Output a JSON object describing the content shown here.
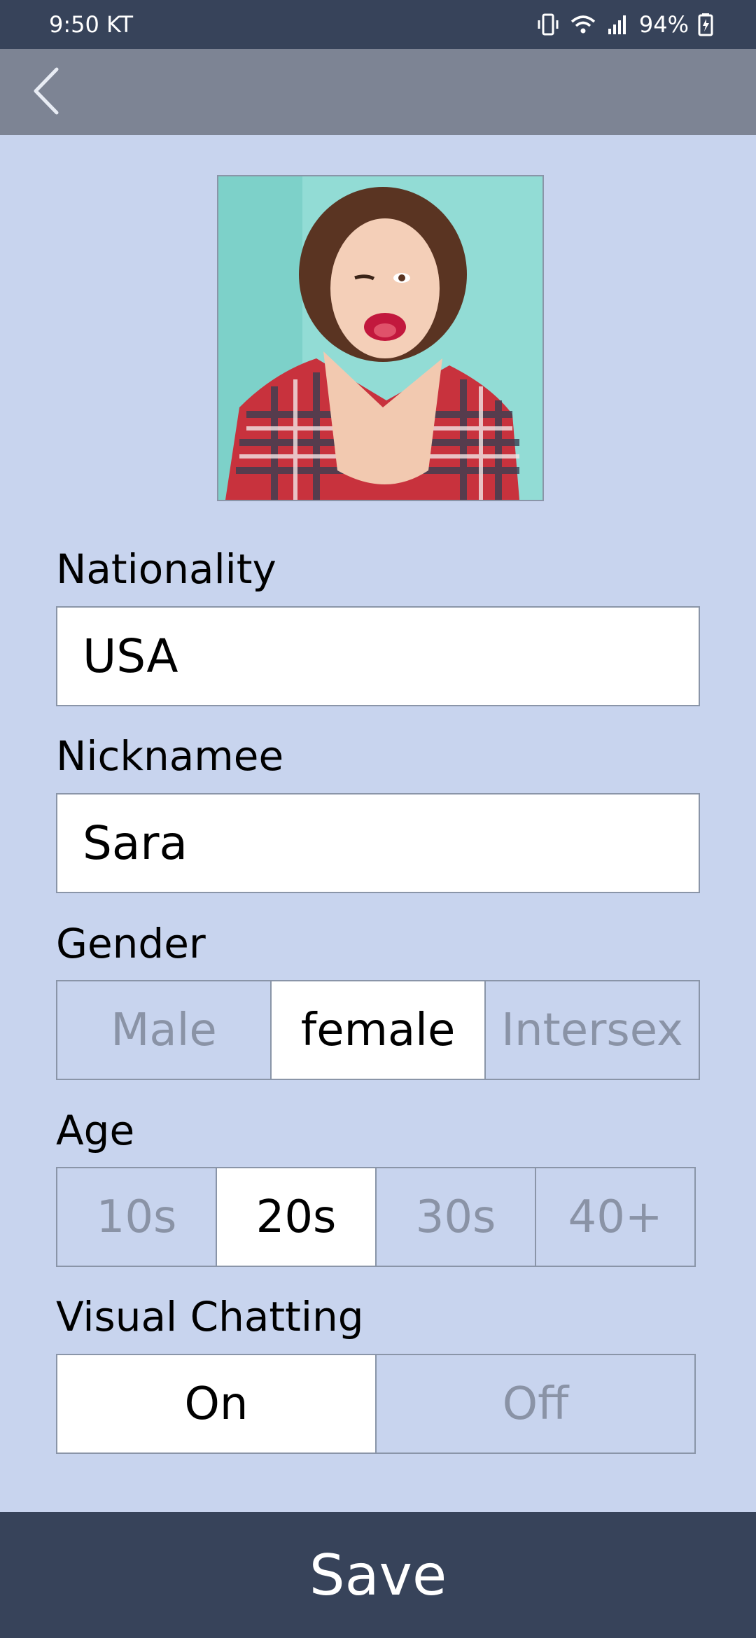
{
  "status_bar": {
    "time": "9:50 KT",
    "battery": "94%"
  },
  "app_bar": {
    "back_icon": "chevron-left-icon"
  },
  "profile": {
    "photo": "profile-photo",
    "colors": {
      "background": "#8fd9d2",
      "shirt": "#c8323d",
      "hair": "#5a3422"
    }
  },
  "form": {
    "nationality": {
      "label": "Nationality",
      "value": "USA"
    },
    "nickname": {
      "label": "Nicknamee",
      "value": "Sara"
    },
    "gender": {
      "label": "Gender",
      "options": [
        "Male",
        "female",
        "Intersex"
      ],
      "selected": "female"
    },
    "age": {
      "label": "Age",
      "options": [
        "10s",
        "20s",
        "30s",
        "40+"
      ],
      "selected": "20s"
    },
    "visual_chatting": {
      "label": "Visual Chatting",
      "options": [
        "On",
        "Off"
      ],
      "selected": "On"
    }
  },
  "save_label": "Save",
  "colors": {
    "page_bg": "#c8d4ee",
    "dark_bar": "#37435a",
    "app_bar": "#7d8494",
    "inactive_text": "#8a93a6",
    "border": "#8a95a8"
  }
}
